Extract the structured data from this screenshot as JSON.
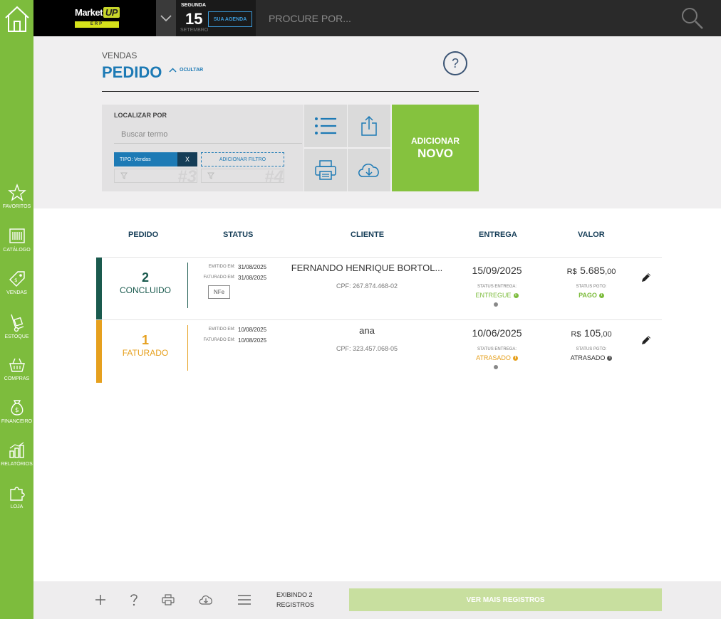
{
  "brand": {
    "name": "Market",
    "up": "UP",
    "tag": "ERP"
  },
  "date": {
    "weekday": "SEGUNDA",
    "day": "15",
    "month": "SETEMBRO",
    "agenda_label": "SUA AGENDA"
  },
  "search": {
    "placeholder": "PROCURE POR..."
  },
  "sidebar": {
    "items": [
      {
        "label": "FAVORITOS",
        "icon": "star-icon"
      },
      {
        "label": "CATÁLOGO",
        "icon": "barcode-icon"
      },
      {
        "label": "VENDAS",
        "icon": "tag-icon"
      },
      {
        "label": "ESTOQUE",
        "icon": "hand-truck-icon"
      },
      {
        "label": "COMPRAS",
        "icon": "basket-icon"
      },
      {
        "label": "FINANCEIRO",
        "icon": "money-bag-icon"
      },
      {
        "label": "RELATÓRIOS",
        "icon": "bar-chart-icon"
      },
      {
        "label": "LOJA",
        "icon": "puzzle-icon"
      }
    ]
  },
  "header": {
    "breadcrumb": "VENDAS",
    "title": "PEDIDO",
    "hide_label": "OCULTAR",
    "help": "?"
  },
  "filter": {
    "find_label": "LOCALIZAR POR",
    "term_placeholder": "Buscar termo",
    "chip_label": "TIPO:  Vendas",
    "chip_close": "X",
    "add_filter": "ADICIONAR FILTRO",
    "slot3": "#3",
    "slot4": "#4"
  },
  "add_new": {
    "line1": "ADICIONAR",
    "line2": "NOVO"
  },
  "table": {
    "headers": {
      "pedido": "PEDIDO",
      "status": "STATUS",
      "cliente": "CLIENTE",
      "entrega": "ENTREGA",
      "valor": "VALOR"
    },
    "rows": [
      {
        "number": "2",
        "status": "CONCLUIDO",
        "emitted_label": "EMITIDO EM:",
        "emitted": "31/08/2025",
        "billed_label": "FATURADO EM:",
        "billed": "31/08/2025",
        "nfe": "NFe",
        "client": "FERNANDO HENRIQUE BORTOL...",
        "cpf": "CPF:  267.874.468-02",
        "delivery_date": "15/09/2025",
        "delivery_status_label": "STATUS ENTREGA:",
        "delivery_status": "ENTREGUE",
        "currency": "R$",
        "amount": "5.685",
        "cents": ",00",
        "pay_status_label": "STATUS PGTO:",
        "pay_status": "PAGO",
        "accent": "#1a5a4e",
        "status_color": "#1a5a4e"
      },
      {
        "number": "1",
        "status": "FATURADO",
        "emitted_label": "EMITIDO EM:",
        "emitted": "10/08/2025",
        "billed_label": "FATURADO EM:",
        "billed": "10/08/2025",
        "client": "ana",
        "cpf": "CPF:  323.457.068-05",
        "delivery_date": "10/06/2025",
        "delivery_status_label": "STATUS ENTREGA:",
        "delivery_status": "ATRASADO",
        "currency": "R$",
        "amount": "105",
        "cents": ",00",
        "pay_status_label": "STATUS PGTO:",
        "pay_status": "ATRASADO",
        "accent": "#e6a01e",
        "status_color": "#e6a01e"
      }
    ]
  },
  "footer": {
    "showing_line1": "EXIBINDO 2",
    "showing_line2": "REGISTROS",
    "more": "VER MAIS REGISTROS"
  },
  "colors": {
    "green": "#7dbc3d",
    "blue": "#1d7ab5",
    "dark": "#2a2a2a"
  }
}
